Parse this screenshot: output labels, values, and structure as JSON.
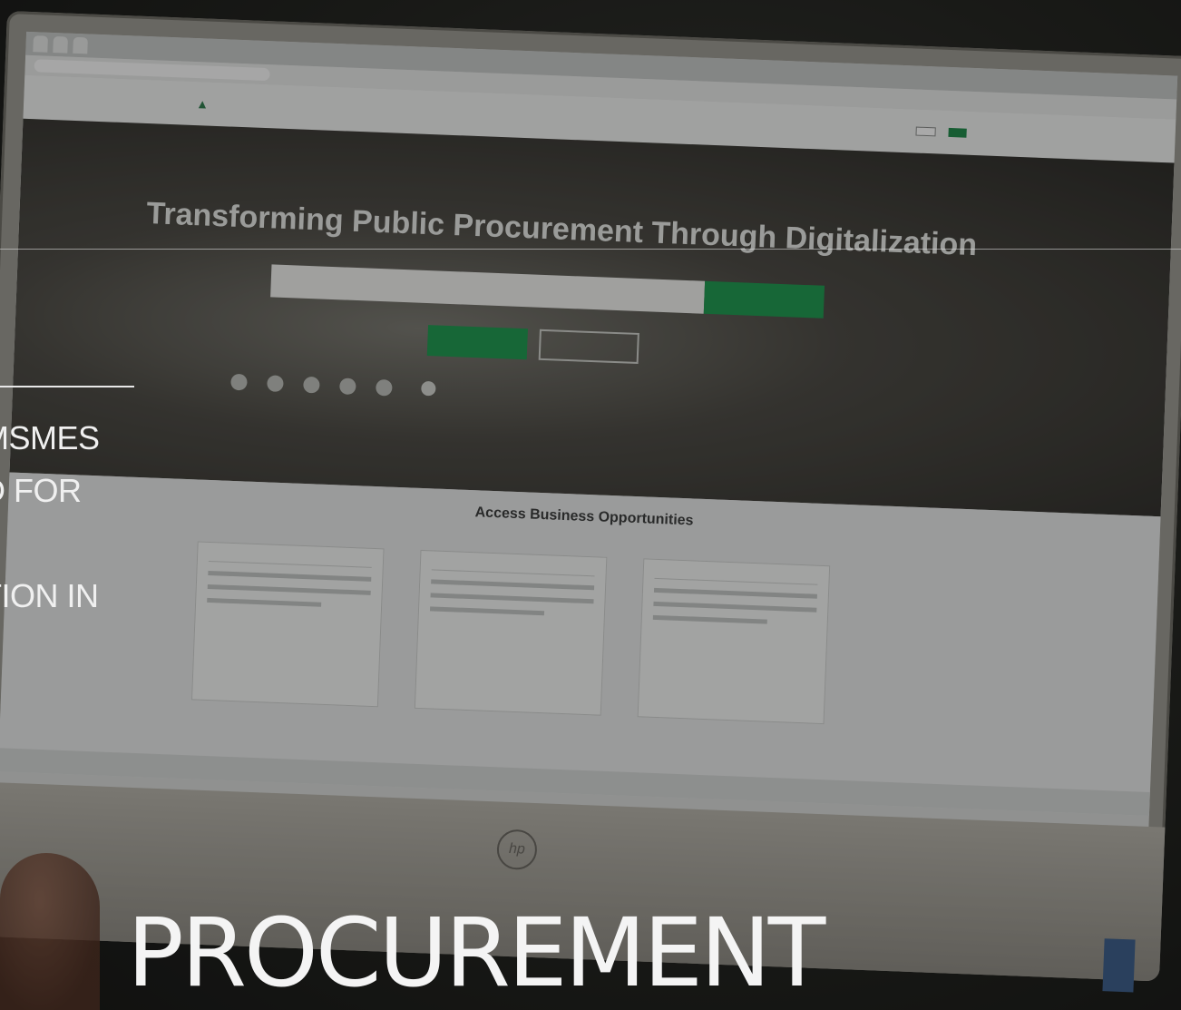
{
  "overlay": {
    "side_lines": [
      "MSMES",
      "D FOR",
      "TION IN"
    ],
    "big_title": "PROCUREMENT"
  },
  "screen": {
    "hero_title": "Transforming Public Procurement Through Digitalization",
    "access_title": "Access Business Opportunities"
  }
}
